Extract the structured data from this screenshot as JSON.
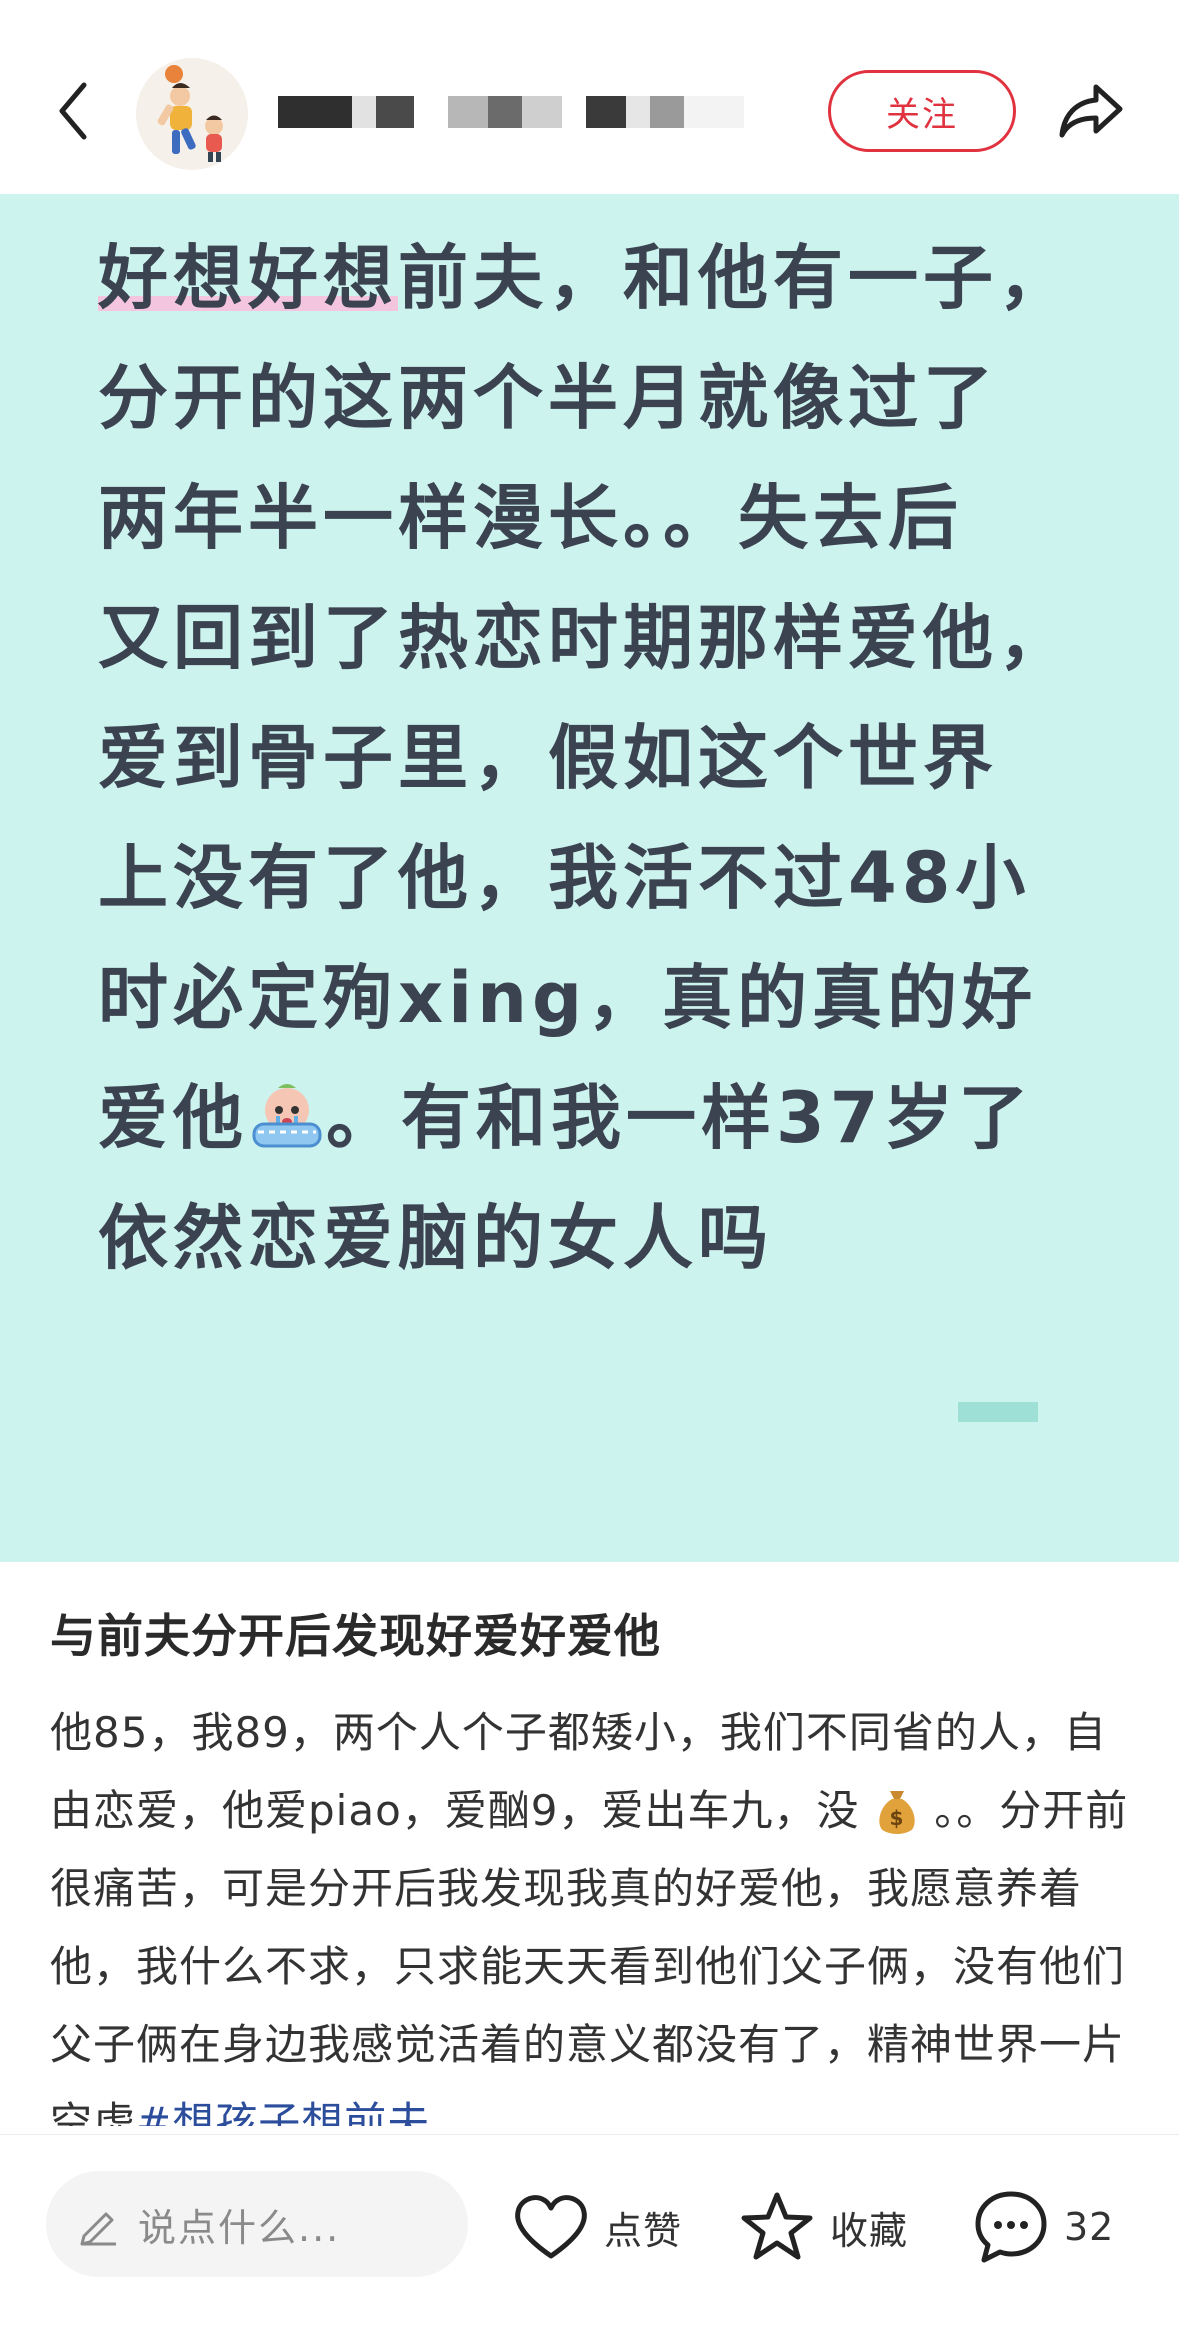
{
  "header": {
    "back_icon": "chevron-left-icon",
    "avatar": "basketball-player-avatar",
    "username_blurred": true,
    "follow_label": "关注",
    "share_icon": "share-arrow-icon",
    "accent_color": "#e0323f"
  },
  "card": {
    "bg_color": "#cdf3ef",
    "text_color": "#3b4250",
    "highlight_text": "好想好想",
    "line1_rest": "前夫，和他有一子，",
    "line2": "分开的这两个半月就像过了",
    "line3": "两年半一样漫长。。失去后",
    "line4": "又回到了热恋时期那样爱他，",
    "line5": "爱到骨子里，假如这个世界",
    "line6": "上没有了他，我活不过48小",
    "line7": "时必定殉xing，真的真的好",
    "line8_a": "爱他",
    "line8_emoji": "crying-in-bath-emoji",
    "line8_b": "。有和我一样37岁了",
    "line9": "依然恋爱脑的女人吗"
  },
  "post": {
    "title": "与前夫分开后发现好爱好爱他",
    "body_part1": "他85，我89，两个人个子都矮小，我们不同省的人，自由恋爱，他爱piao，爱酗9，爱出车九，没",
    "money_icon": "money-bag-icon",
    "body_part2": "。。分开前很痛苦，可是分开后我发现我真的好爱他，我愿意养着他，我什么不求，只求能天天看到他们父子俩，没有他们父子俩在身边我感觉活着的意义都没有了，精神世界一片空虚",
    "hashtag": "#想孩子想前夫"
  },
  "bottom_bar": {
    "comment_placeholder": "说点什么...",
    "pencil_icon": "pencil-icon",
    "like_label": "点赞",
    "like_icon": "heart-icon",
    "collect_label": "收藏",
    "collect_icon": "star-icon",
    "comment_icon": "chat-bubble-icon",
    "comment_count": "32"
  }
}
